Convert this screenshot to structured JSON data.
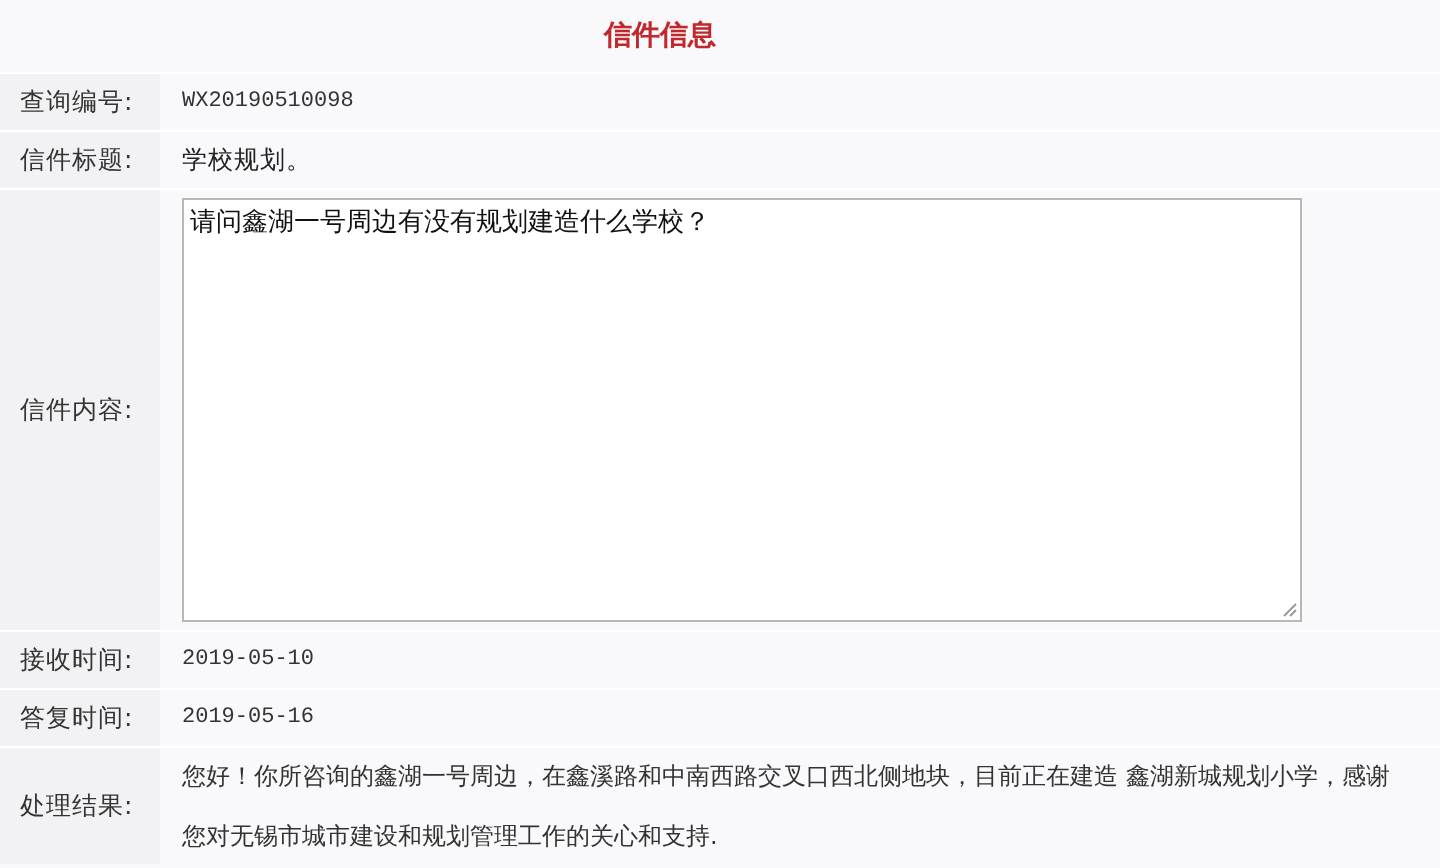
{
  "title": "信件信息",
  "rows": [
    {
      "kind": "text",
      "label": "查询编号:",
      "value": "WX20190510098"
    },
    {
      "kind": "text",
      "label": "信件标题:",
      "value": "学校规划。"
    },
    {
      "kind": "textarea",
      "label": "信件内容:",
      "value": "请问鑫湖一号周边有没有规划建造什么学校？"
    },
    {
      "kind": "text",
      "label": "接收时间:",
      "value": "2019-05-10"
    },
    {
      "kind": "text",
      "label": "答复时间:",
      "value": "2019-05-16"
    },
    {
      "kind": "paragraph",
      "label": "处理结果:",
      "value": "您好！你所咨询的鑫湖一号周边，在鑫溪路和中南西路交叉口西北侧地块，目前正在建造 鑫湖新城规划小学，感谢您对无锡市城市建设和规划管理工作的关心和支持."
    }
  ]
}
